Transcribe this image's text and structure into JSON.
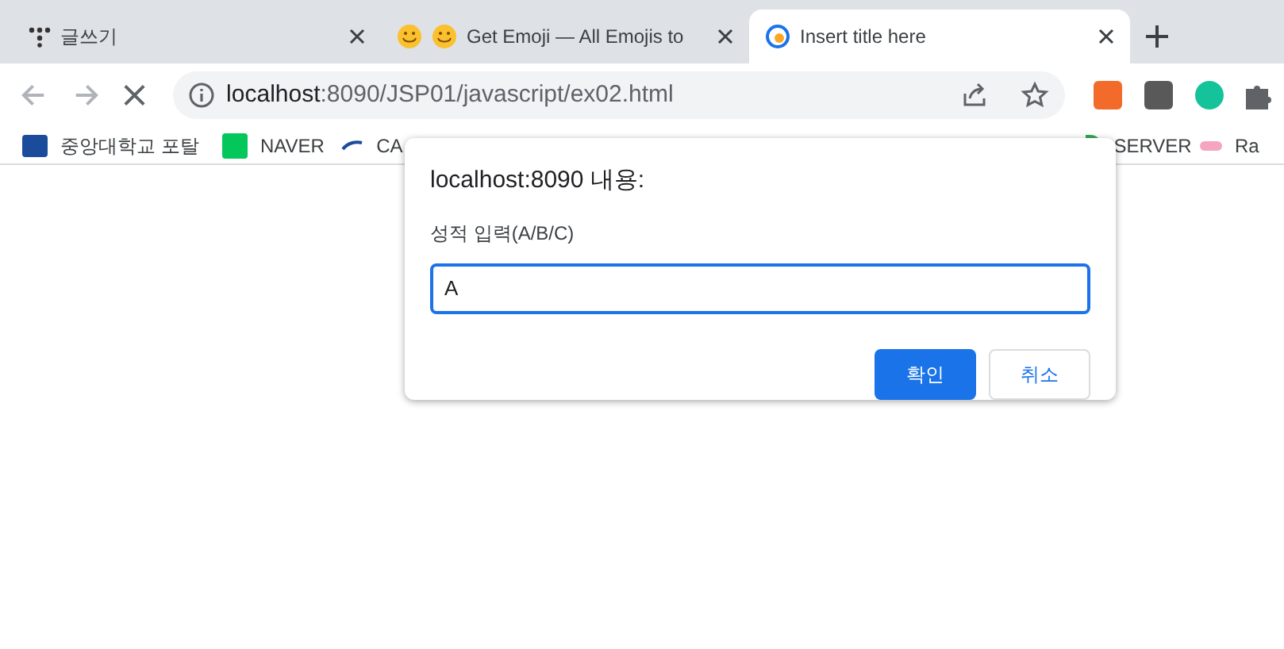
{
  "tabs": [
    {
      "title": "글쓰기",
      "selected": false
    },
    {
      "title": "Get Emoji — All Emojis to",
      "selected": false
    },
    {
      "title": "Insert title here",
      "selected": true
    }
  ],
  "address_bar": {
    "host": "localhost",
    "rest": ":8090/JSP01/javascript/ex02.html"
  },
  "bookmarks": [
    {
      "label": "중앙대학교 포탈"
    },
    {
      "label": "NAVER"
    },
    {
      "label": "CA"
    },
    {
      "label": "SERVER"
    },
    {
      "label": "Ra"
    }
  ],
  "dialog": {
    "title": "localhost:8090 내용:",
    "message": "성적 입력(A/B/C)",
    "value": "A",
    "buttons": [
      {
        "label": "확인",
        "kind": "primary"
      },
      {
        "label": "취소",
        "kind": "secondary"
      }
    ]
  }
}
